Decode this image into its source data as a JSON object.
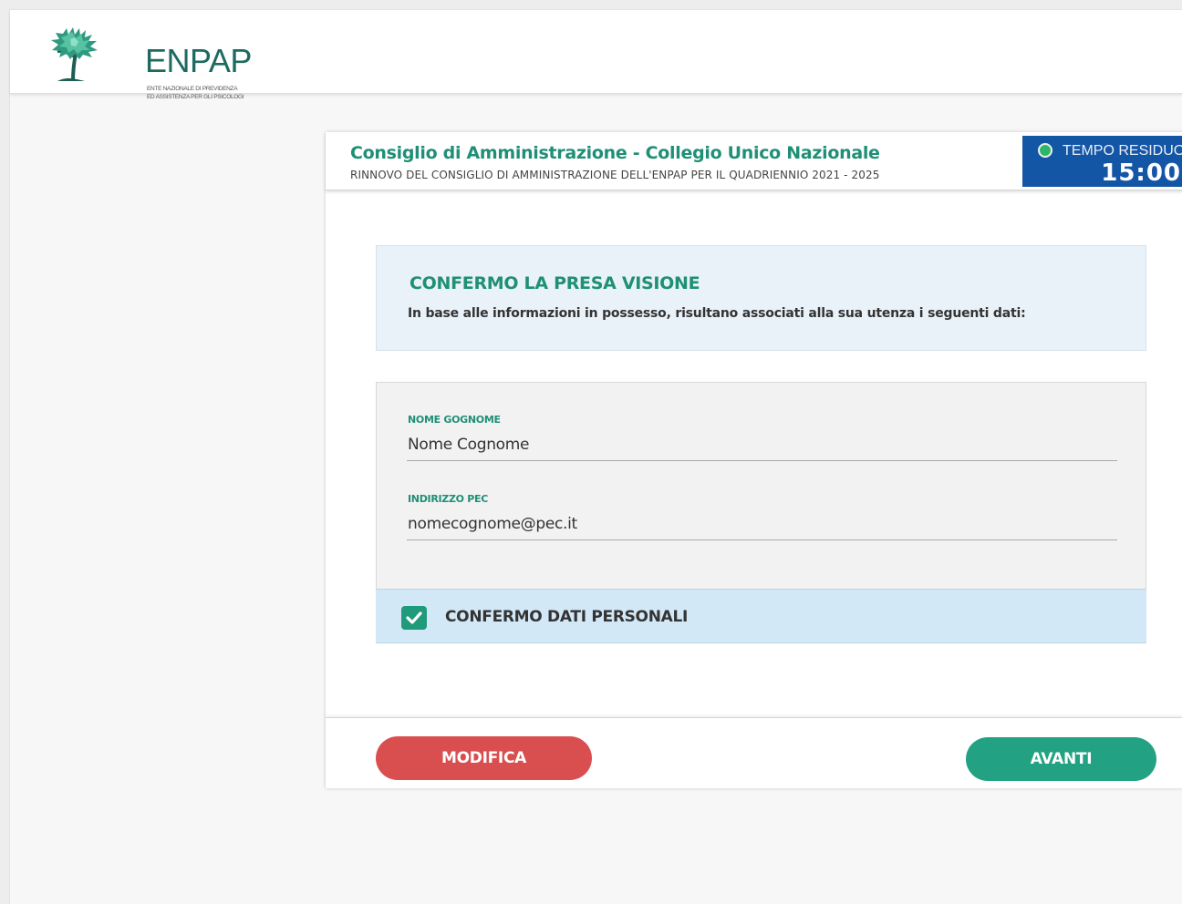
{
  "header": {
    "logo_name": "ENPAP",
    "logo_subtitle_line1": "ENTE NAZIONALE DI PREVIDENZA",
    "logo_subtitle_line2": "ED ASSISTENZA PER GLI PSICOLOGI"
  },
  "card": {
    "title": "Consiglio di Amministrazione - Collegio Unico Nazionale",
    "subtitle": "RINNOVO DEL CONSIGLIO DI AMMINISTRAZIONE DELL'ENPAP PER IL QUADRIENNIO  2021 - 2025"
  },
  "timer": {
    "label": "TEMPO RESIDUO",
    "value": "15:00",
    "status_color": "#2fb56a",
    "background_color": "#1456a6"
  },
  "info": {
    "title": "CONFERMO LA PRESA VISIONE",
    "text": "In base alle informazioni in possesso, risultano associati alla sua utenza i seguenti dati:"
  },
  "fields": [
    {
      "label": "NOME GOGNOME",
      "value": "Nome Cognome"
    },
    {
      "label": "INDIRIZZO PEC",
      "value": "nomecognome@pec.it"
    }
  ],
  "confirm": {
    "label": "CONFERMO DATI PERSONALI",
    "checked": true
  },
  "buttons": {
    "modifica": "MODIFICA",
    "avanti": "AVANTI"
  },
  "colors": {
    "accent_green": "#1f8f76",
    "button_red": "#d94f50",
    "button_green": "#22a283"
  }
}
